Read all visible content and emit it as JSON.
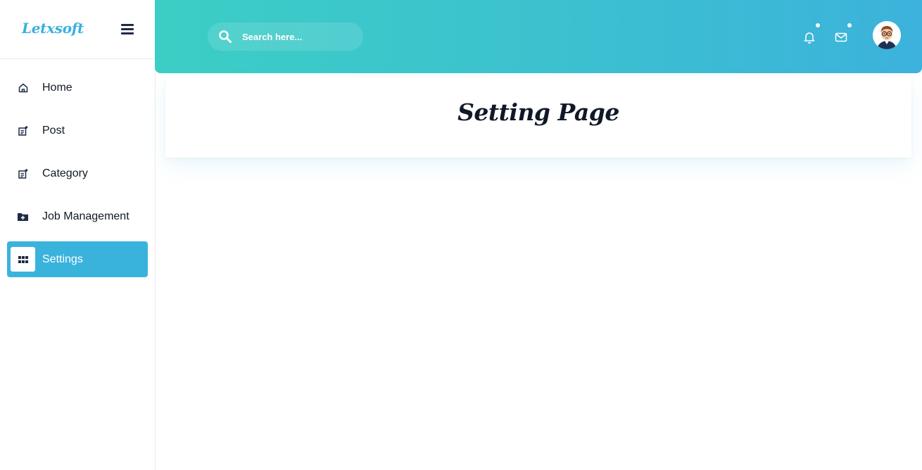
{
  "brand": {
    "logo_text": "Letxsoft"
  },
  "sidebar": {
    "items": [
      {
        "label": "Home",
        "icon": "home-icon",
        "active": false
      },
      {
        "label": "Post",
        "icon": "post-add-icon",
        "active": false
      },
      {
        "label": "Category",
        "icon": "post-add-icon",
        "active": false
      },
      {
        "label": "Job Management",
        "icon": "folder-plus-icon",
        "active": false
      },
      {
        "label": "Settings",
        "icon": "grid-icon",
        "active": true
      }
    ]
  },
  "header": {
    "search": {
      "placeholder": "Search here..."
    },
    "icons": [
      "bell-icon",
      "mail-icon",
      "avatar"
    ]
  },
  "main": {
    "title": "Setting Page"
  },
  "colors": {
    "accent": "#3ab3dc",
    "header_gradient_start": "#3ccec5",
    "header_gradient_end": "#3cb2dc",
    "nav_icon": "#1f2a44"
  }
}
